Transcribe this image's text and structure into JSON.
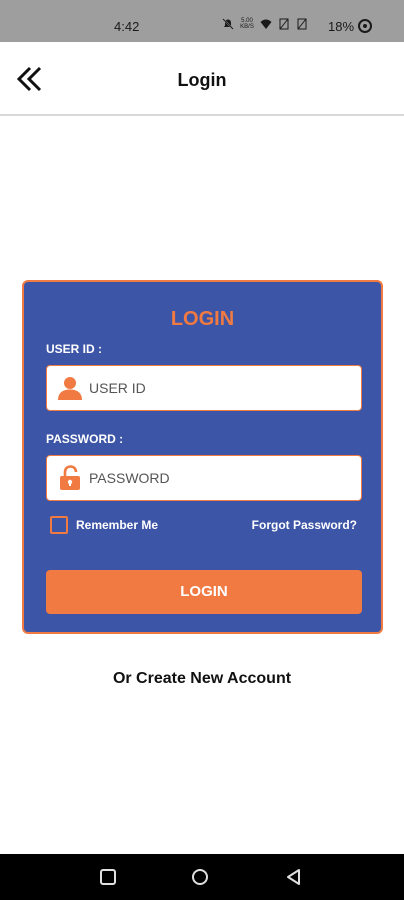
{
  "status_bar": {
    "time": "4:42",
    "network_speed": "5.00 KB/S",
    "battery": "18%",
    "icons": [
      "mute-icon",
      "network-speed",
      "wifi-icon",
      "sim-icon",
      "sim-icon",
      "battery-icon"
    ]
  },
  "header": {
    "title": "Login",
    "back_icon": "double-chevron-left-icon"
  },
  "login_card": {
    "title": "LOGIN",
    "user_label": "USER ID :",
    "user_placeholder": "USER ID",
    "user_icon": "user-icon",
    "password_label": "PASSWORD :",
    "password_placeholder": "PASSWORD",
    "password_icon": "unlock-icon",
    "remember_label": "Remember Me",
    "remember_checked": false,
    "forgot_label": "Forgot Password?",
    "submit_label": "LOGIN"
  },
  "create_account_label": "Or Create New Account",
  "nav_bar": {
    "icons": [
      "square-recents-icon",
      "circle-home-icon",
      "triangle-back-icon"
    ]
  },
  "colors": {
    "card_bg": "#3d55a6",
    "accent": "#f07a42",
    "status_bar": "#9e9e9e",
    "nav_bar": "#000000"
  }
}
